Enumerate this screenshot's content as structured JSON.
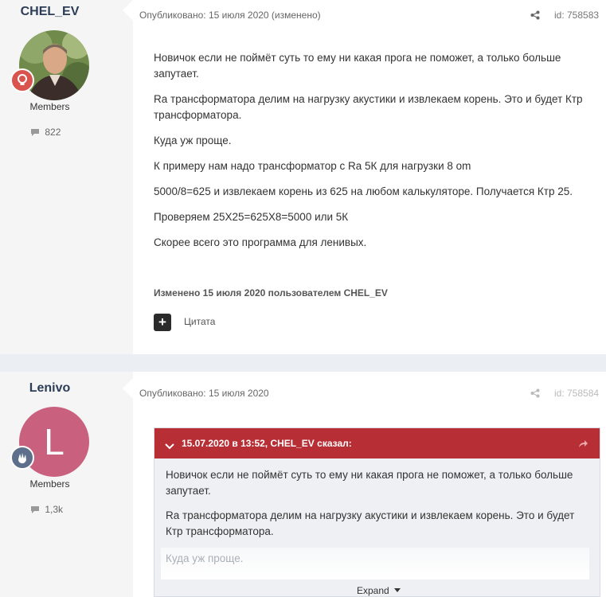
{
  "post1": {
    "author": "CHEL_EV",
    "group": "Members",
    "post_count": "822",
    "meta": "Опубликовано: 15 июля 2020 (изменено)",
    "post_id": "id: 758583",
    "paragraphs": [
      "Новичок если не поймёт суть то ему ни какая прога не поможет, а только больше запутает.",
      "Ra трансформатора делим на нагрузку акустики и извлекаем корень. Это и будет Ктр трансформатора.",
      "Куда уж проще.",
      "К примеру нам надо трансформатор с  Ra 5К для нагрузки 8 om",
      "5000/8=625 и извлекаем корень из 625 на любом калькуляторе. Получается Ктр 25.",
      "Проверяем 25Х25=625Х8=5000 или 5К",
      "Скорее всего это программа для ленивых."
    ],
    "edited_note": "Изменено 15 июля 2020 пользователем CHEL_EV",
    "quote_label": "Цитата"
  },
  "post2": {
    "author": "Lenivo",
    "avatar_letter": "L",
    "group": "Members",
    "post_count": "1,3k",
    "meta": "Опубликовано: 15 июля 2020",
    "post_id": "id: 758584",
    "quote": {
      "header": "15.07.2020 в 13:52, CHEL_EV сказал:",
      "paragraphs": [
        "Новичок если не поймёт суть то ему ни какая прога не поможет, а только больше запутает.",
        "Ra трансформатора делим на нагрузку акустики и извлекаем корень. Это и будет Ктр трансформатора."
      ],
      "faded_text": "Куда уж проще.",
      "expand_label": "Expand"
    }
  },
  "colors": {
    "quote_header": "#b82e35",
    "avatar_lenivo": "#c9607e",
    "badge_idea": "#d9534f",
    "badge_wave": "#5d6f8a"
  },
  "icons": [
    "share-icon",
    "comment-icon",
    "lightbulb-icon",
    "wave-hand-icon",
    "plus-icon",
    "chevron-down-icon",
    "reply-arrow-icon"
  ]
}
